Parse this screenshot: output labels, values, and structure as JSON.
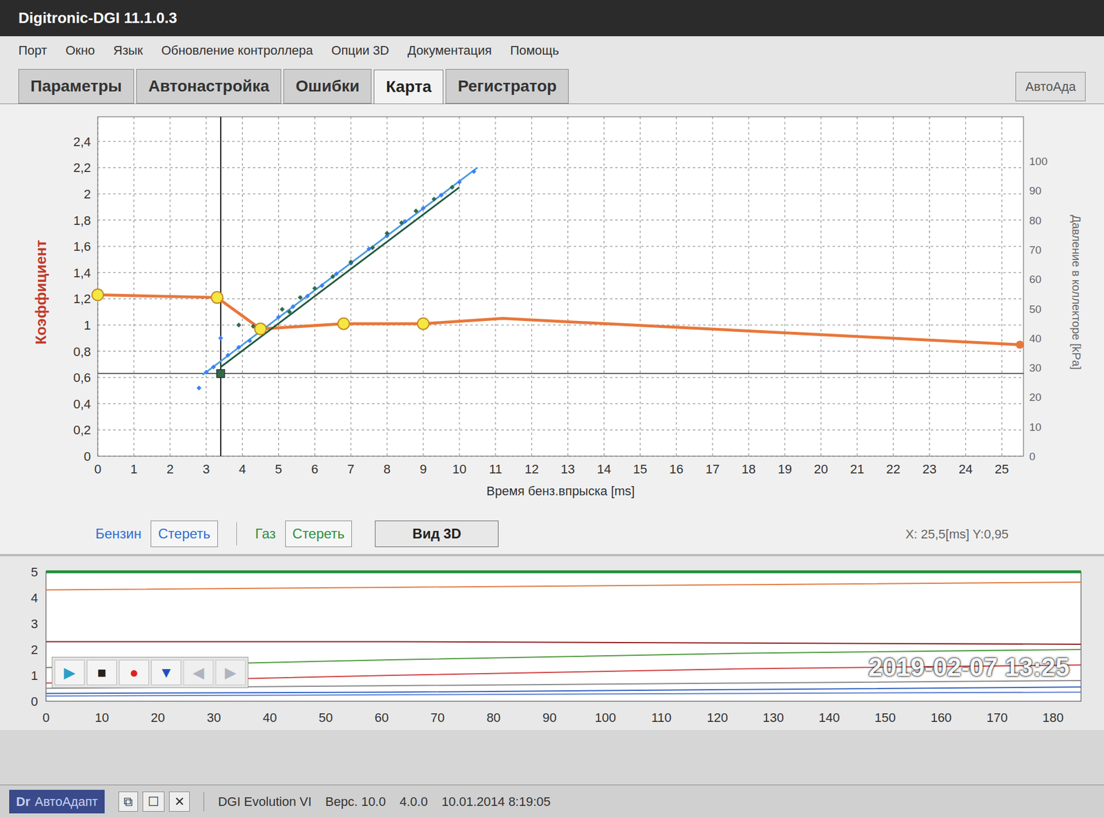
{
  "window": {
    "title": "Digitronic-DGI 11.1.0.3"
  },
  "menu": [
    "Порт",
    "Окно",
    "Язык",
    "Обновление контроллера",
    "Опции 3D",
    "Документация",
    "Помощь"
  ],
  "tabs": [
    {
      "label": "Параметры",
      "selected": false
    },
    {
      "label": "Автонастройка",
      "selected": false
    },
    {
      "label": "Ошибки",
      "selected": false
    },
    {
      "label": "Карта",
      "selected": true
    },
    {
      "label": "Регистратор",
      "selected": false
    }
  ],
  "side_button": "АвтоАда",
  "map_chart": {
    "y_label": "Коэффициент",
    "y_ticks": [
      "0",
      "0,2",
      "0,4",
      "0,6",
      "0,8",
      "1",
      "1,2",
      "1,4",
      "1,6",
      "1,8",
      "2",
      "2,2",
      "2,4"
    ],
    "y2_label": "Давление в коллекторе [kPa]",
    "y2_ticks": [
      "0",
      "10",
      "20",
      "30",
      "40",
      "50",
      "60",
      "70",
      "80",
      "90",
      "100"
    ],
    "x_label": "Время бенз.впрыска [ms]",
    "x_ticks": [
      "0",
      "1",
      "2",
      "3",
      "4",
      "5",
      "6",
      "7",
      "8",
      "9",
      "10",
      "11",
      "12",
      "13",
      "14",
      "15",
      "16",
      "17",
      "18",
      "19",
      "20",
      "21",
      "22",
      "23",
      "24",
      "25"
    ],
    "coefficient": {
      "color": "#e8773a",
      "x": [
        0,
        3.3,
        4.5,
        6.8,
        9,
        11.2,
        25.5
      ],
      "y": [
        1.23,
        1.21,
        0.97,
        1.01,
        1.01,
        1.05,
        0.85
      ]
    },
    "handles": {
      "color": "#f5e642",
      "x": [
        0,
        3.3,
        4.5,
        6.8,
        9
      ],
      "y": [
        1.23,
        1.21,
        0.97,
        1.01,
        1.01
      ]
    },
    "end_handle": {
      "x": 25.5,
      "y": 0.85
    },
    "petrol_points": {
      "color": "#3b82f6",
      "x": [
        2.8,
        3.0,
        3.2,
        3.4,
        3.6,
        3.9,
        4.2,
        4.6,
        5.0,
        5.4,
        5.8,
        6.2,
        6.6,
        7.0,
        7.5,
        8.0,
        8.5,
        9.0,
        9.5,
        10.0,
        10.4
      ],
      "y": [
        0.52,
        0.64,
        0.68,
        0.9,
        0.77,
        0.83,
        0.88,
        0.97,
        1.06,
        1.14,
        1.22,
        1.3,
        1.39,
        1.47,
        1.58,
        1.68,
        1.79,
        1.89,
        1.99,
        2.09,
        2.17
      ]
    },
    "petrol_fit": {
      "color": "#4a9be0",
      "x": [
        2.9,
        10.5
      ],
      "y": [
        0.62,
        2.2
      ]
    },
    "gas_points": {
      "color": "#2f6b4a",
      "x": [
        3.9,
        4.3,
        5.1,
        5.3,
        5.6,
        6.0,
        6.5,
        7.0,
        7.6,
        8.0,
        8.4,
        8.8,
        9.3,
        9.8
      ],
      "y": [
        1.0,
        0.99,
        1.12,
        1.1,
        1.21,
        1.28,
        1.37,
        1.48,
        1.59,
        1.7,
        1.78,
        1.87,
        1.96,
        2.05
      ]
    },
    "gas_fit": {
      "color": "#1f5a3e",
      "x": [
        3.4,
        10.0
      ],
      "y": [
        0.68,
        2.05
      ]
    },
    "cursor": {
      "x": 3.4,
      "y": 0.63
    }
  },
  "controls": {
    "petrol_label": "Бензин",
    "petrol_clear": "Стереть",
    "gas_label": "Газ",
    "gas_clear": "Стереть",
    "view_3d": "Вид 3D",
    "readout": "X: 25,5[ms] Y:0,95"
  },
  "recorder": {
    "y_ticks": [
      "0",
      "1",
      "2",
      "3",
      "4",
      "5"
    ],
    "x_ticks": [
      "0",
      "10",
      "20",
      "30",
      "40",
      "50",
      "60",
      "70",
      "80",
      "90",
      "100",
      "110",
      "120",
      "130",
      "140",
      "150",
      "160",
      "170",
      "180"
    ],
    "lines": [
      {
        "color": "#1f8f3a",
        "values": [
          5,
          5,
          5,
          5
        ]
      },
      {
        "color": "#e07a40",
        "values": [
          4.3,
          4.4,
          4.5,
          4.6
        ]
      },
      {
        "color": "#8b1f1f",
        "values": [
          2.3,
          2.3,
          2.25,
          2.2
        ]
      },
      {
        "color": "#4f9a3f",
        "values": [
          1.3,
          1.6,
          1.85,
          2.0
        ]
      },
      {
        "color": "#d04040",
        "values": [
          0.7,
          1.0,
          1.25,
          1.4
        ]
      },
      {
        "color": "#888888",
        "values": [
          0.5,
          0.6,
          0.7,
          0.8
        ]
      },
      {
        "color": "#3060c0",
        "values": [
          0.3,
          0.35,
          0.45,
          0.55
        ]
      },
      {
        "color": "#6080d0",
        "values": [
          0.2,
          0.25,
          0.3,
          0.35
        ]
      }
    ],
    "buttons": [
      {
        "glyph": "▶",
        "color": "#2aa0c8",
        "disabled": false
      },
      {
        "glyph": "■",
        "color": "#222222",
        "disabled": false
      },
      {
        "glyph": "●",
        "color": "#e02020",
        "disabled": false
      },
      {
        "glyph": "▼",
        "color": "#2050c0",
        "disabled": false
      },
      {
        "glyph": "◀",
        "color": "#9aa0b0",
        "disabled": true
      },
      {
        "glyph": "▶",
        "color": "#9aa0b0",
        "disabled": true
      }
    ]
  },
  "taskbar": {
    "logo": "Dr",
    "app": "АвтоАдапт",
    "icons": [
      "⧉",
      "☐",
      "✕"
    ]
  },
  "status": [
    "DGI Evolution VI",
    "Верс. 10.0",
    "4.0.0",
    "10.01.2014 8:19:05"
  ],
  "timestamp": "2019-02-07  13:25"
}
